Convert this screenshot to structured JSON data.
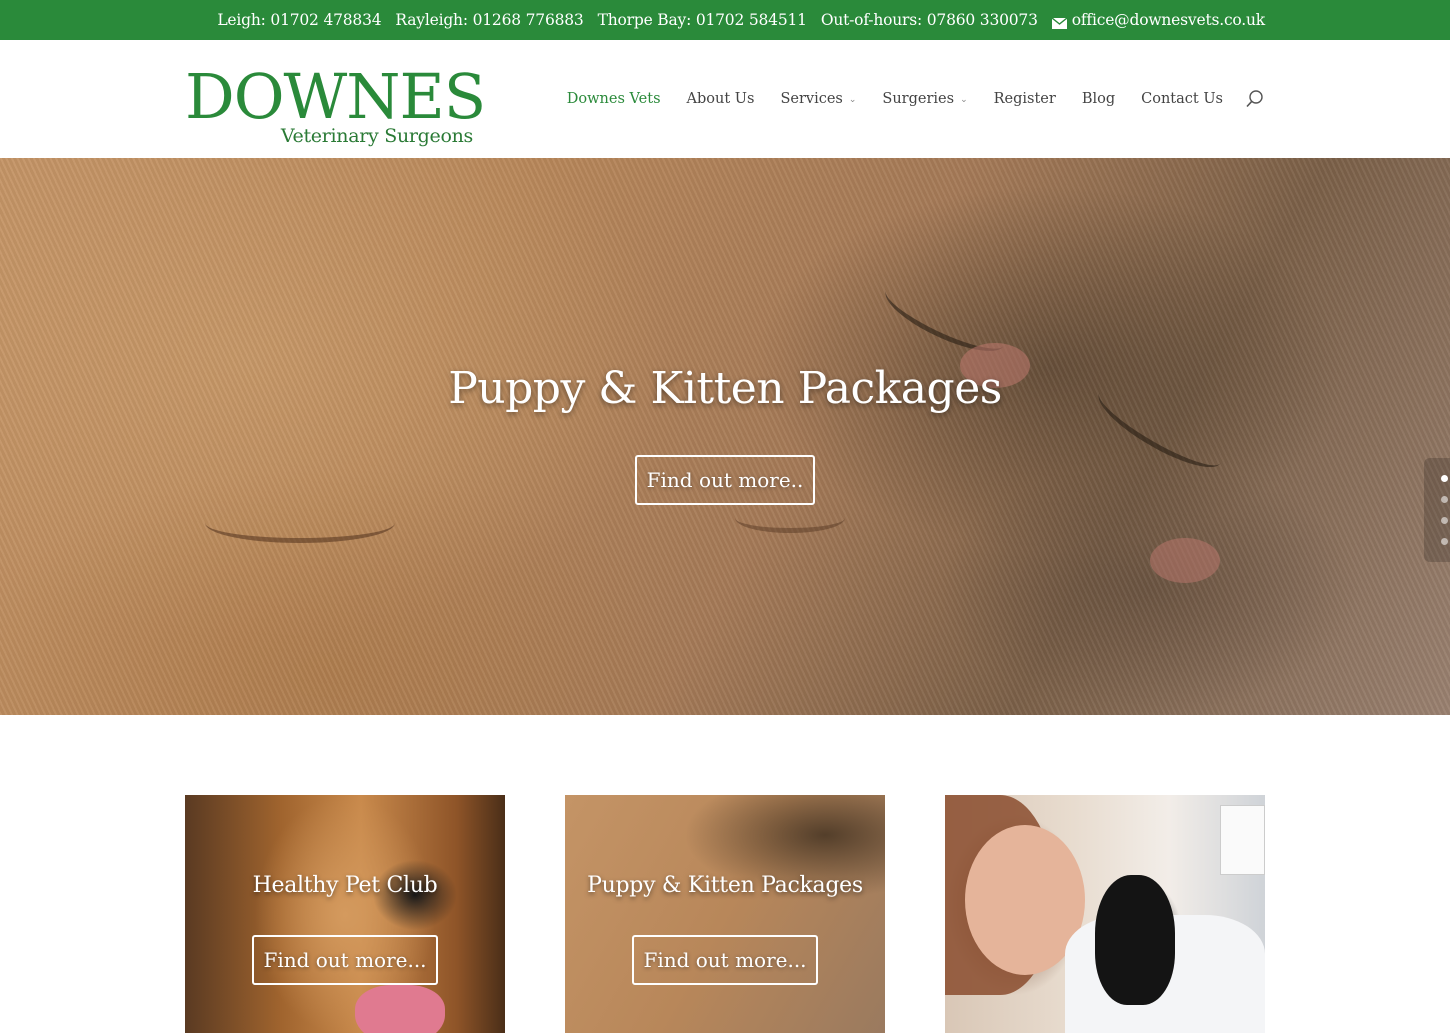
{
  "topbar": {
    "phones": [
      "Leigh: 01702 478834",
      "Rayleigh: 01268 776883",
      "Thorpe Bay: 01702 584511",
      "Out-of-hours: 07860 330073"
    ],
    "email": "office@downesvets.co.uk",
    "background": "#2a8a3a"
  },
  "logo": {
    "wordmark": "DOWNES",
    "subtitle": "Veterinary Surgeons"
  },
  "nav": {
    "items": [
      {
        "label": "Downes Vets",
        "active": true
      },
      {
        "label": "About Us"
      },
      {
        "label": "Services",
        "dropdown": true
      },
      {
        "label": "Surgeries",
        "dropdown": true
      },
      {
        "label": "Register"
      },
      {
        "label": "Blog"
      },
      {
        "label": "Contact Us"
      }
    ],
    "search_icon": "search-icon",
    "active_color": "#2a8a3a"
  },
  "hero": {
    "title": "Puppy & Kitten Packages",
    "button": "Find out more..",
    "slides": 4,
    "active_slide": 1
  },
  "cards": [
    {
      "title": "Healthy Pet Club",
      "button": "Find out more..."
    },
    {
      "title": "Puppy & Kitten Packages",
      "button": "Find out more..."
    }
  ]
}
